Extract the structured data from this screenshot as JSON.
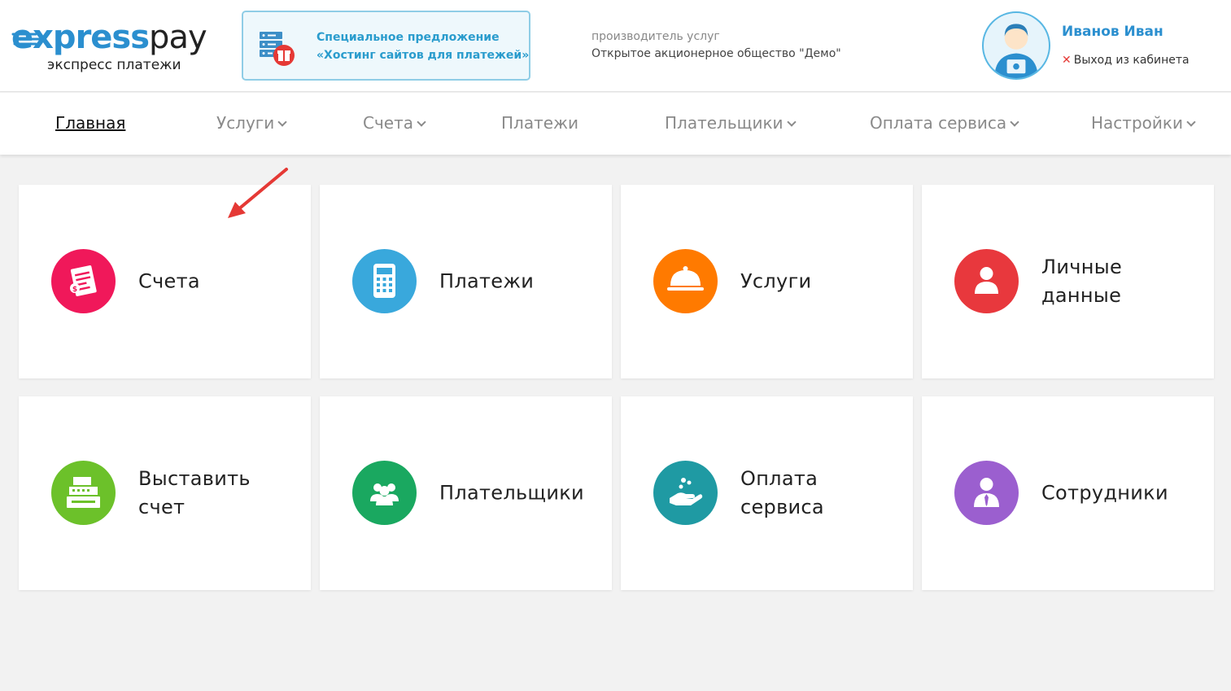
{
  "header": {
    "logo": {
      "word_express": "express",
      "word_pay": "pay",
      "subtitle": "экспресс платежи"
    },
    "promo": {
      "line1": "Специальное предложение",
      "line2": "«Хостинг сайтов для платежей»"
    },
    "provider": {
      "caption": "производитель услуг",
      "name": "Открытое акционерное общество \"Демо\""
    },
    "user": {
      "name": "Иванов Иван",
      "logout_label": "Выход из кабинета"
    }
  },
  "nav": {
    "items": [
      {
        "label": "Главная"
      },
      {
        "label": "Услуги"
      },
      {
        "label": "Счета"
      },
      {
        "label": "Платежи"
      },
      {
        "label": "Плательщики"
      },
      {
        "label": "Оплата сервиса"
      },
      {
        "label": "Настройки"
      }
    ]
  },
  "tiles": [
    {
      "label": "Счета",
      "icon": "invoice-icon",
      "color": "#f0185a"
    },
    {
      "label": "Платежи",
      "icon": "calculator-icon",
      "color": "#39a8dc"
    },
    {
      "label": "Услуги",
      "icon": "cloche-icon",
      "color": "#ff7a00"
    },
    {
      "label": "Личные данные",
      "icon": "person-icon",
      "color": "#e8383d"
    },
    {
      "label": "Выставить счет",
      "icon": "cash-register-icon",
      "color": "#6cc12a"
    },
    {
      "label": "Плательщики",
      "icon": "group-icon",
      "color": "#1aa860"
    },
    {
      "label": "Оплата сервиса",
      "icon": "hand-coins-icon",
      "color": "#1f9aa3"
    },
    {
      "label": "Сотрудники",
      "icon": "employee-icon",
      "color": "#9b5fcf"
    }
  ],
  "colors": {
    "brand": "#2b8fcf",
    "accent_arrow": "#e53935"
  }
}
